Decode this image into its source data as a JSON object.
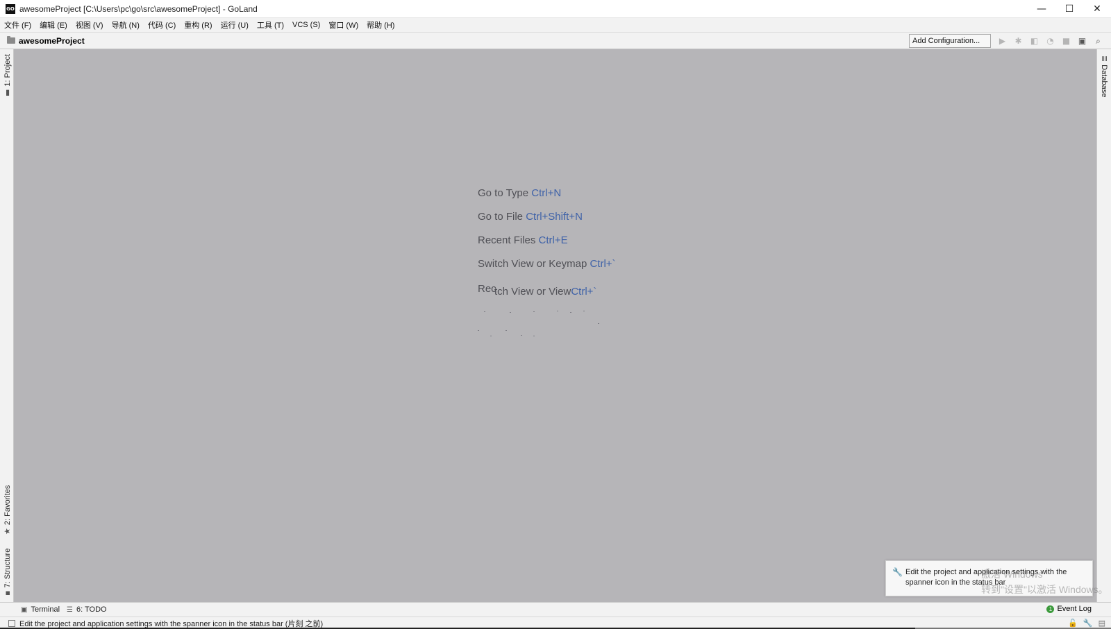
{
  "window": {
    "title": "awesomeProject [C:\\Users\\pc\\go\\src\\awesomeProject] - GoLand",
    "logo_text": "GO",
    "minimize": "—",
    "maximize": "☐",
    "close": "✕"
  },
  "menu": [
    {
      "label": "文件 (F)"
    },
    {
      "label": "编辑 (E)"
    },
    {
      "label": "视图 (V)"
    },
    {
      "label": "导航 (N)"
    },
    {
      "label": "代码 (C)"
    },
    {
      "label": "重构 (R)"
    },
    {
      "label": "运行 (U)"
    },
    {
      "label": "工具 (T)"
    },
    {
      "label": "VCS (S)"
    },
    {
      "label": "窗口 (W)"
    },
    {
      "label": "帮助 (H)"
    }
  ],
  "navbar": {
    "project_name": "awesomeProject",
    "add_configuration": "Add Configuration..."
  },
  "toolbar_icons": [
    "run-icon",
    "debug-icon",
    "coverage-icon",
    "profile-icon",
    "stop-icon",
    "frame-icon",
    "search-icon"
  ],
  "left_tabs": {
    "project": "1: Project",
    "favorites": "2: Favorites",
    "structure": "7: Structure"
  },
  "right_tabs": {
    "database": "Database"
  },
  "hints": [
    {
      "text": "Go to Type",
      "key": "Ctrl+N"
    },
    {
      "text": "Go to File",
      "key": "Ctrl+Shift+N"
    },
    {
      "text": "Recent Files",
      "key": "Ctrl+E"
    },
    {
      "text": "Switch View or Keymap",
      "key": "Ctrl+`"
    }
  ],
  "overlap_hint": {
    "a": "Rec",
    "b_text": "tch View or View",
    "b_key": "Ctrl+`"
  },
  "tooltip": {
    "text": "Edit the project and application settings with the spanner icon in the status bar"
  },
  "watermark": {
    "line1": "激活 Windows",
    "line2": "转到\"设置\"以激活 Windows。"
  },
  "bottom_tabs": {
    "terminal": "Terminal",
    "todo": "6: TODO",
    "event_log": "Event Log",
    "event_count": "1"
  },
  "status": {
    "text": "Edit the project and application settings with the spanner icon in the status bar (片刻 之前)"
  },
  "colors": {
    "editor_bg": "#b6b5b8",
    "hint_key": "#3f62a8",
    "hint_text": "#4f4f55"
  }
}
